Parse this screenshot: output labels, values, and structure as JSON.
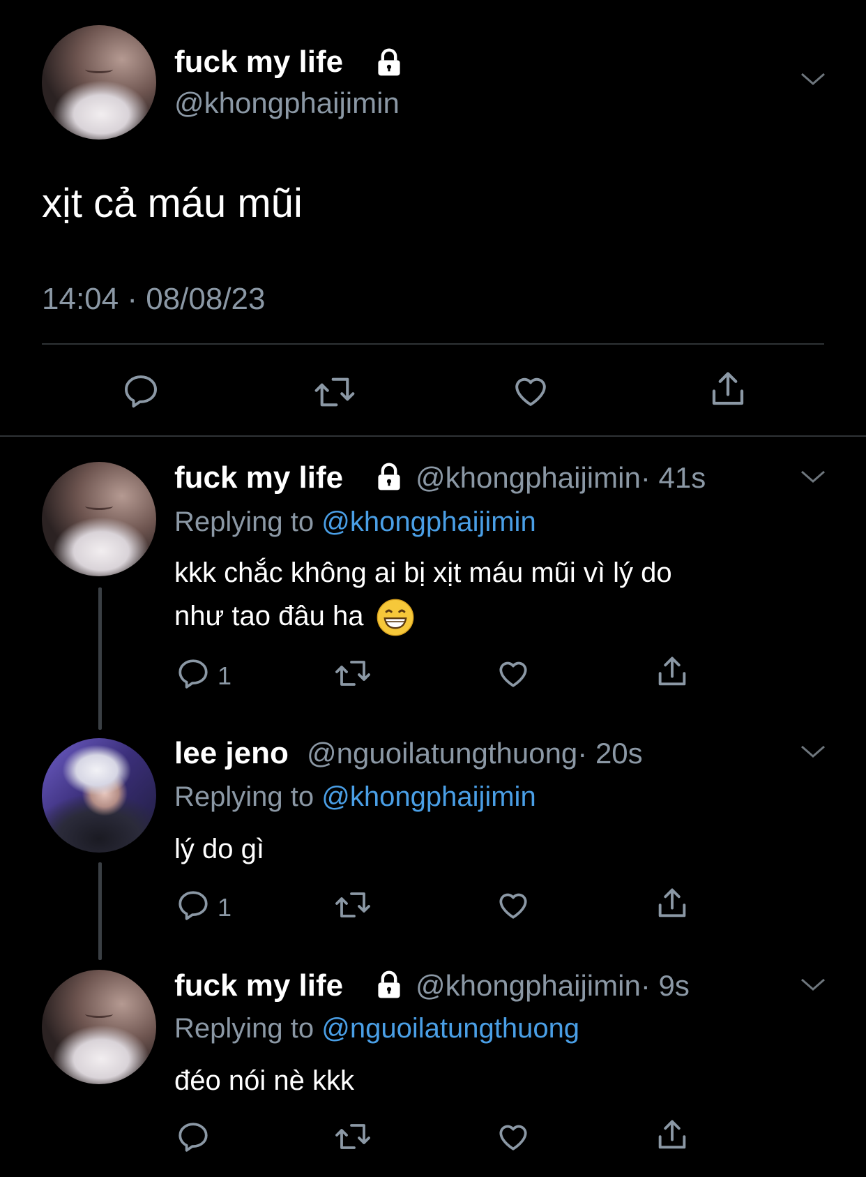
{
  "main_tweet": {
    "display_name": "fuck my life",
    "handle": "@khongphaijimin",
    "text": "xịt cả máu mũi",
    "timestamp": "14:04 · 08/08/23",
    "protected": true,
    "avatar": "closed-eyes-selfie"
  },
  "replies": [
    {
      "display_name": "fuck my life",
      "handle": "@khongphaijimin",
      "time": "· 41s",
      "replying_prefix": "Replying to",
      "replying_to": "@khongphaijimin",
      "text_line1": "kkk chắc không ai bị xịt máu mũi vì lý do",
      "text_line2": "như tao đâu ha",
      "emoji": "😁",
      "reply_count": "1",
      "protected": true
    },
    {
      "display_name": "lee jeno",
      "handle": "@nguoilatungthuong",
      "time": "· 20s",
      "replying_prefix": "Replying to",
      "replying_to": "@khongphaijimin",
      "text": "lý do gì",
      "reply_count": "1",
      "protected": false
    },
    {
      "display_name": "fuck my life",
      "handle": "@khongphaijimin",
      "time": "· 9s",
      "replying_prefix": "Replying to",
      "replying_to": "@nguoilatungthuong",
      "text": "đéo nói nè kkk",
      "reply_count": "",
      "protected": true
    }
  ],
  "icons": [
    "lock-icon",
    "chevron-down-icon",
    "reply-icon",
    "retweet-icon",
    "like-icon",
    "share-icon"
  ],
  "colors": {
    "background": "#000000",
    "text": "#ffffff",
    "secondary": "#8b98a5",
    "mention": "#4a9fe6",
    "divider": "#2f3336"
  }
}
